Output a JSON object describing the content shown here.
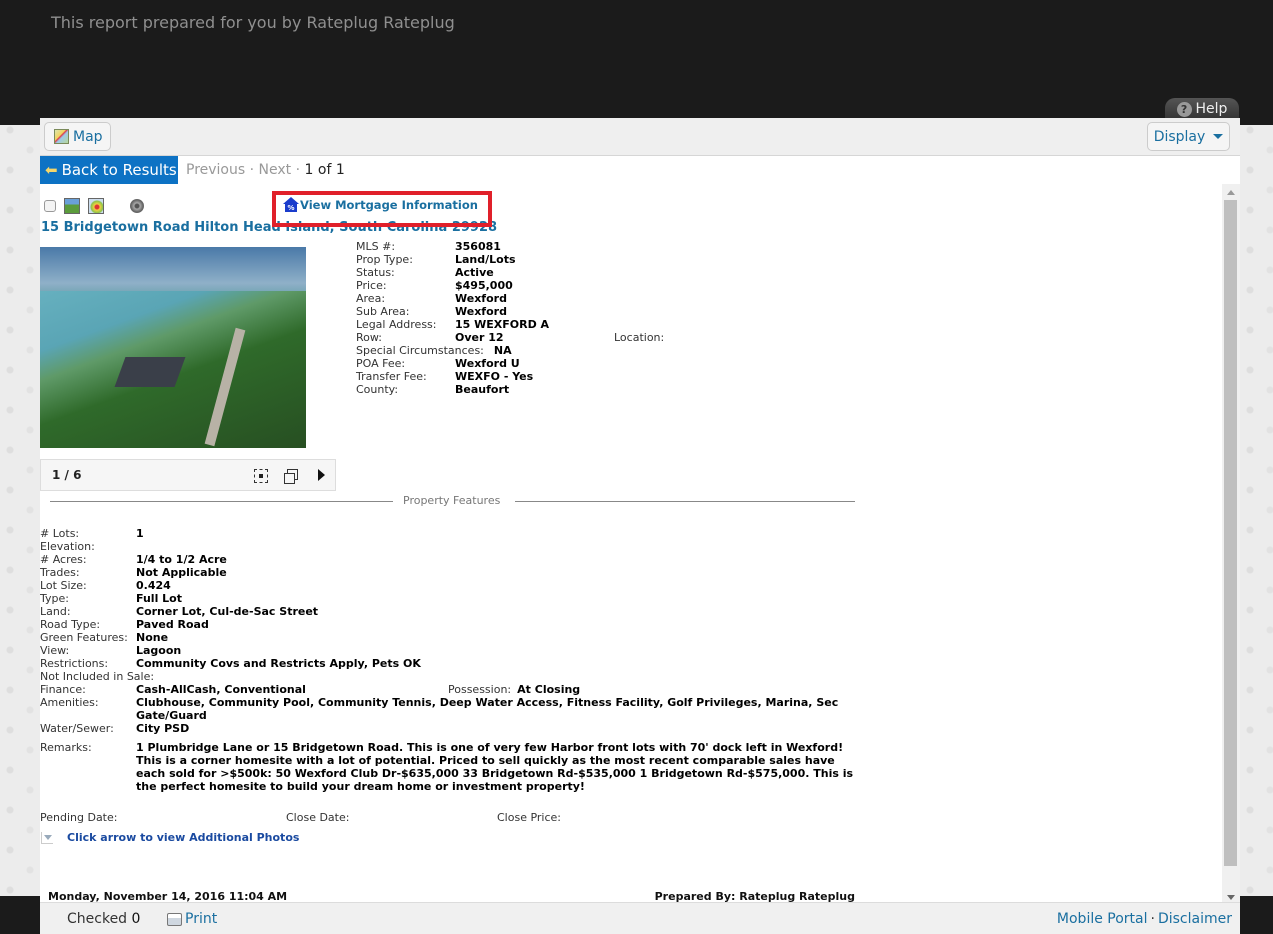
{
  "header": {
    "prepared_text": "This report prepared for you by Rateplug Rateplug",
    "help_label": "Help"
  },
  "toolbar": {
    "map_label": "Map",
    "display_label": "Display"
  },
  "nav": {
    "back_label": "Back to Results",
    "previous_label": "Previous",
    "next_label": "Next",
    "separator": "·",
    "count": "1 of 1"
  },
  "listing": {
    "mortgage_link": "View Mortgage Information",
    "address": "15 Bridgetown Road Hilton Head Island, South Carolina 29928",
    "gallery_count": "1 / 6",
    "details": [
      {
        "label": "MLS #:",
        "value": "356081"
      },
      {
        "label": "Prop Type:",
        "value": "Land/Lots"
      },
      {
        "label": "Status:",
        "value": "Active"
      },
      {
        "label": "Price:",
        "value": "$495,000"
      },
      {
        "label": "Area:",
        "value": "Wexford"
      },
      {
        "label": "Sub Area:",
        "value": "Wexford"
      },
      {
        "label": "Legal Address:",
        "value": "15 WEXFORD A"
      },
      {
        "label": "Row:",
        "value": "Over 12"
      },
      {
        "label": "Special Circumstances:",
        "value": "NA"
      },
      {
        "label": "POA Fee:",
        "value": "Wexford U"
      },
      {
        "label": "Transfer Fee:",
        "value": "WEXFO - Yes"
      },
      {
        "label": "County:",
        "value": "Beaufort"
      }
    ],
    "location_label": "Location:",
    "section_title": "Property Features",
    "features": [
      {
        "label": "# Lots:",
        "value": "1"
      },
      {
        "label": "Elevation:",
        "value": ""
      },
      {
        "label": "# Acres:",
        "value": "1/4 to 1/2 Acre"
      },
      {
        "label": "Trades:",
        "value": "Not Applicable"
      },
      {
        "label": "Lot Size:",
        "value": "0.424"
      },
      {
        "label": "Type:",
        "value": "Full Lot"
      },
      {
        "label": "Land:",
        "value": "Corner Lot, Cul-de-Sac Street"
      },
      {
        "label": "Road Type:",
        "value": "Paved Road"
      },
      {
        "label": "Green Features:",
        "value": "None"
      },
      {
        "label": "View:",
        "value": "Lagoon"
      },
      {
        "label": "Restrictions:",
        "value": "Community Covs and Restricts Apply, Pets OK"
      },
      {
        "label": "Not Included in Sale:",
        "value": ""
      }
    ],
    "finance": {
      "label": "Finance:",
      "value": "Cash-AllCash, Conventional"
    },
    "possession": {
      "label": "Possession:",
      "value": "At Closing"
    },
    "amenities": {
      "label": "Amenities:",
      "value": "Clubhouse, Community Pool, Community Tennis, Deep Water Access, Fitness Facility, Golf Privileges, Marina, Sec Gate/Guard"
    },
    "water_sewer": {
      "label": "Water/Sewer:",
      "value": "City PSD"
    },
    "remarks": {
      "label": "Remarks:",
      "value": "1 Plumbridge Lane or 15 Bridgetown Road. This is one of very few Harbor front lots with 70' dock left in Wexford! This is a corner homesite with a lot of potential. Priced to sell quickly as the most recent comparable sales have each sold for >$500k: 50 Wexford Club Dr-$635,000 33 Bridgetown Rd-$535,000 1 Bridgetown Rd-$575,000. This is the perfect homesite to build your dream home or investment property!"
    },
    "pending_date_label": "Pending Date:",
    "close_date_label": "Close Date:",
    "close_price_label": "Close Price:",
    "additional_photos": "Click arrow to view Additional Photos",
    "report_date": "Monday, November 14, 2016 11:04 AM",
    "prepared_by": "Prepared By: Rateplug Rateplug"
  },
  "footer": {
    "checked_label": "Checked",
    "checked_count": "0",
    "print_label": "Print",
    "mobile_portal": "Mobile Portal",
    "separator": "·",
    "disclaimer": "Disclaimer"
  },
  "colors": {
    "accent": "#0d72c4",
    "link": "#1a6fa0",
    "highlight_box": "#e0202a",
    "topbar": "#1b1b1b"
  }
}
